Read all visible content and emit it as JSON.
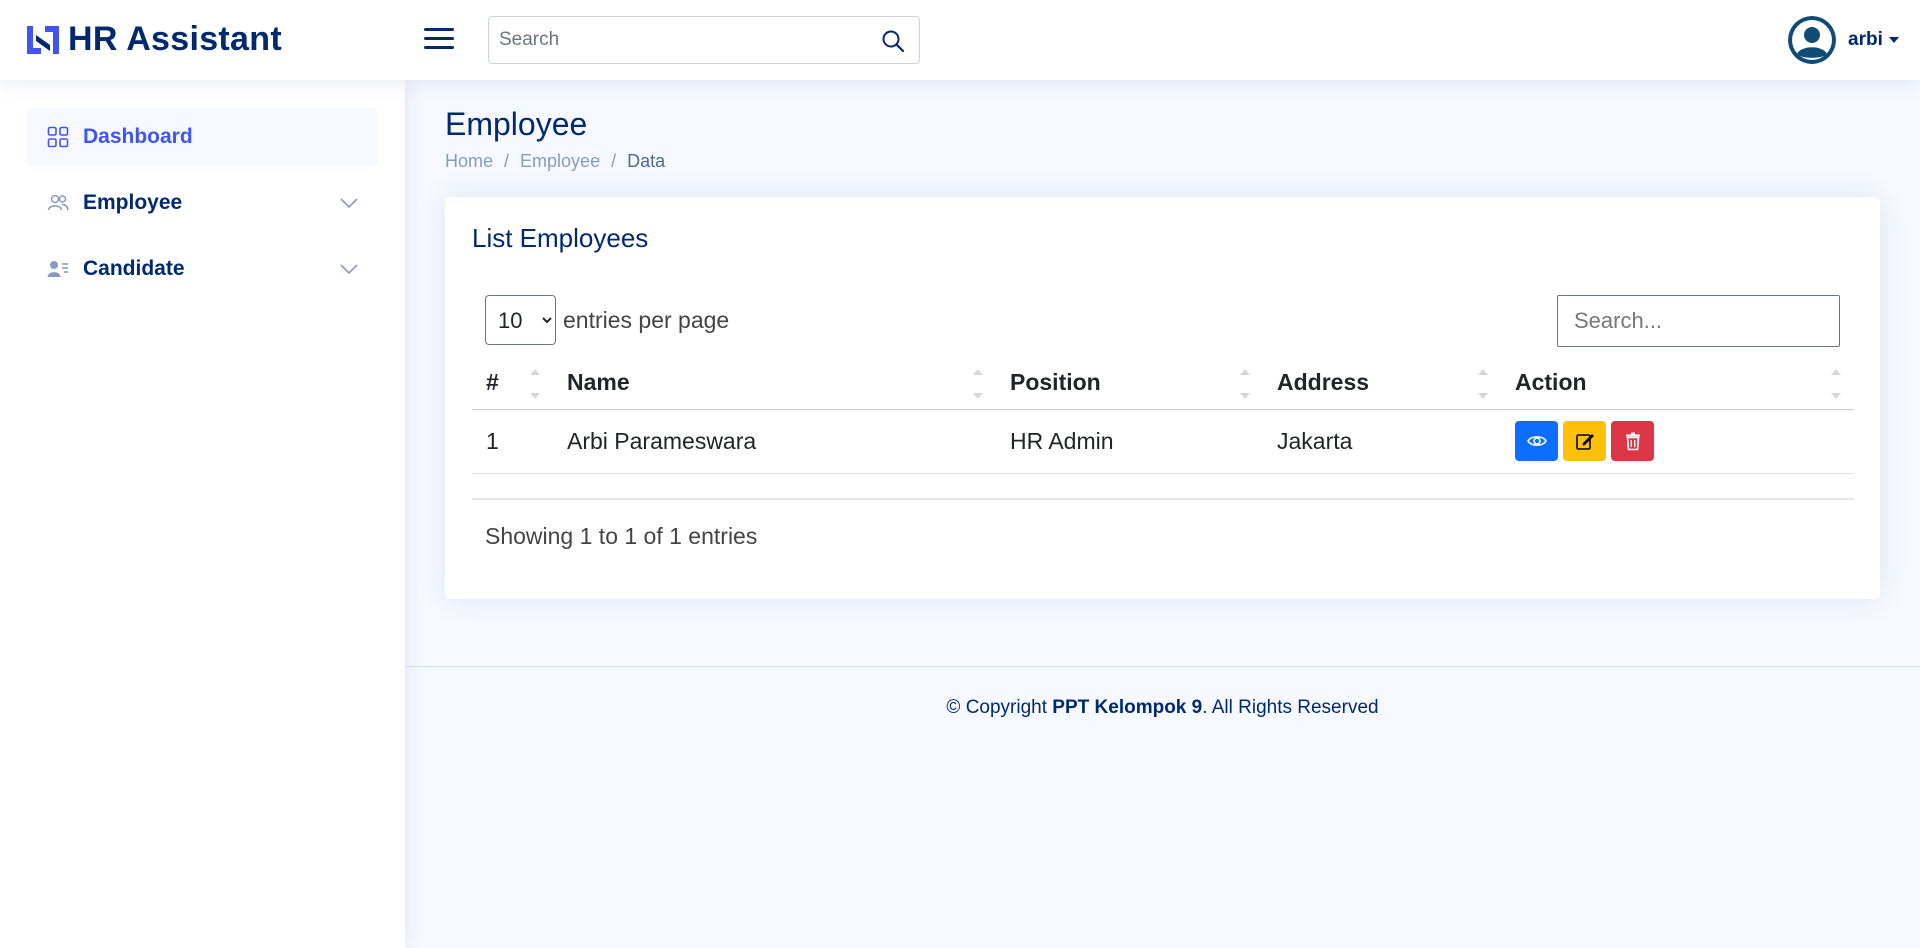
{
  "header": {
    "app_title": "HR Assistant",
    "search_placeholder": "Search",
    "user_name": "arbi"
  },
  "sidebar": {
    "items": [
      {
        "label": "Dashboard",
        "icon": "grid-icon",
        "active": true
      },
      {
        "label": "Employee",
        "icon": "people-icon",
        "expandable": true
      },
      {
        "label": "Candidate",
        "icon": "person-lines-icon",
        "expandable": true
      }
    ]
  },
  "page": {
    "title": "Employee",
    "breadcrumb": [
      "Home",
      "Employee",
      "Data"
    ]
  },
  "card": {
    "title": "List Employees",
    "per_page_value": "10",
    "per_page_options": [
      "10"
    ],
    "per_page_label": "entries per page",
    "search_placeholder": "Search...",
    "columns": [
      "#",
      "Name",
      "Position",
      "Address",
      "Action"
    ],
    "rows": [
      {
        "num": "1",
        "name": "Arbi Parameswara",
        "position": "HR Admin",
        "address": "Jakarta"
      }
    ],
    "showing": "Showing 1 to 1 of 1 entries"
  },
  "footer": {
    "prefix": "© Copyright ",
    "owner": "PPT Kelompok 9",
    "suffix": ". All Rights Reserved"
  },
  "colors": {
    "primary": "#012970",
    "accent": "#4154f1",
    "view": "#0d6efd",
    "edit": "#ffc107",
    "delete": "#dc3545",
    "background": "#f6f9ff"
  }
}
